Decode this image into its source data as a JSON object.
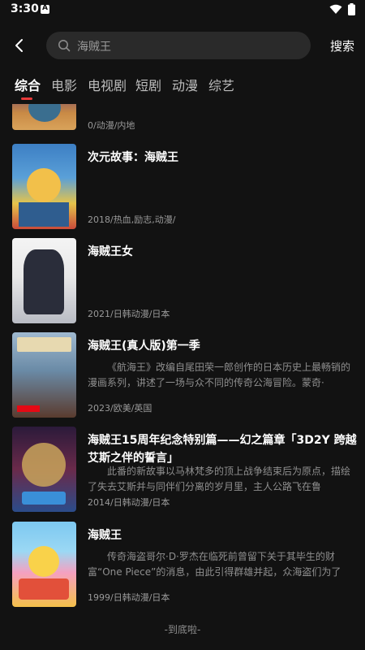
{
  "status": {
    "time": "3:30"
  },
  "search": {
    "query": "海贼王",
    "button_label": "搜索"
  },
  "tabs": [
    "综合",
    "电影",
    "电视剧",
    "短剧",
    "动漫",
    "综艺"
  ],
  "results": [
    {
      "title": "",
      "description": "",
      "meta": "0/动漫/内地"
    },
    {
      "title": "次元故事：海贼王",
      "description": "",
      "meta": "2018/热血,励志,动漫/"
    },
    {
      "title": "海贼王女",
      "description": "",
      "meta": "2021/日韩动漫/日本"
    },
    {
      "title": "海贼王(真人版)第一季",
      "description": "《航海王》改编自尾田荣一郎创作的日本历史上最畅销的漫画系列，讲述了一场与众不同的传奇公海冒险。蒙奇·",
      "meta": "2023/欧美/英国"
    },
    {
      "title": "海贼王15周年纪念特别篇——幻之篇章「3D2Y 跨越艾斯之伴的誓言」",
      "description": "此番的新故事以马林梵多的顶上战争结束后为原点，描绘了失去艾斯并与同伴们分离的岁月里，主人公路飞在鲁",
      "meta": "2014/日韩动漫/日本"
    },
    {
      "title": "海贼王",
      "description": "传奇海盗哥尔·D·罗杰在临死前曾留下关于其毕生的财富“One Piece”的消息，由此引得群雄并起，众海盗们为了",
      "meta": "1999/日韩动漫/日本"
    }
  ],
  "footer": {
    "end_text": "-到底啦-"
  }
}
